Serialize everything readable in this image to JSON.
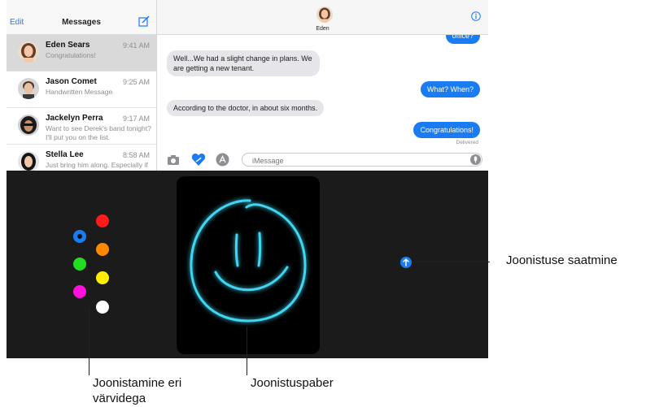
{
  "sidebar": {
    "edit_label": "Edit",
    "title": "Messages",
    "compose_icon": "compose-icon",
    "conversations": [
      {
        "name": "Eden Sears",
        "time": "9:41 AM",
        "preview": "Congratulations!"
      },
      {
        "name": "Jason Comet",
        "time": "9:25 AM",
        "preview": "Handwritten Message"
      },
      {
        "name": "Jackelyn Perra",
        "time": "9:17 AM",
        "preview": "Want to see Derek's band tonight? I'll put you on the list."
      },
      {
        "name": "Stella Lee",
        "time": "8:58 AM",
        "preview": "Just bring him along. Especially if he's single."
      }
    ]
  },
  "chat": {
    "contact_name": "Eden",
    "top_partial_text": "office?",
    "messages": [
      {
        "side": "in",
        "text": "Well...We had a slight change in plans. We are getting a new tenant."
      },
      {
        "side": "out",
        "text": "What? When?"
      },
      {
        "side": "in",
        "text": "According to the doctor, in about six months."
      },
      {
        "side": "out",
        "text": "Congratulations!"
      }
    ],
    "delivered": "Delivered",
    "input_placeholder": "iMessage"
  },
  "drawing": {
    "colors": [
      "#1a7cf5",
      "#ff1b1b",
      "#ff8800",
      "#22dd22",
      "#ffee00",
      "#ff11dd",
      "#ffffff"
    ],
    "selected_color": "#1a7cf5",
    "stroke_color": "#3fd6f2"
  },
  "callouts": {
    "send": "Joonistuse saatmine",
    "colors": "Joonistamine eri värvidega",
    "canvas": "Joonistuspaber"
  },
  "colors": {
    "accent": "#1a7cf5",
    "dark_bg": "#1b1b1b",
    "bubble_in": "#e5e5ea"
  }
}
